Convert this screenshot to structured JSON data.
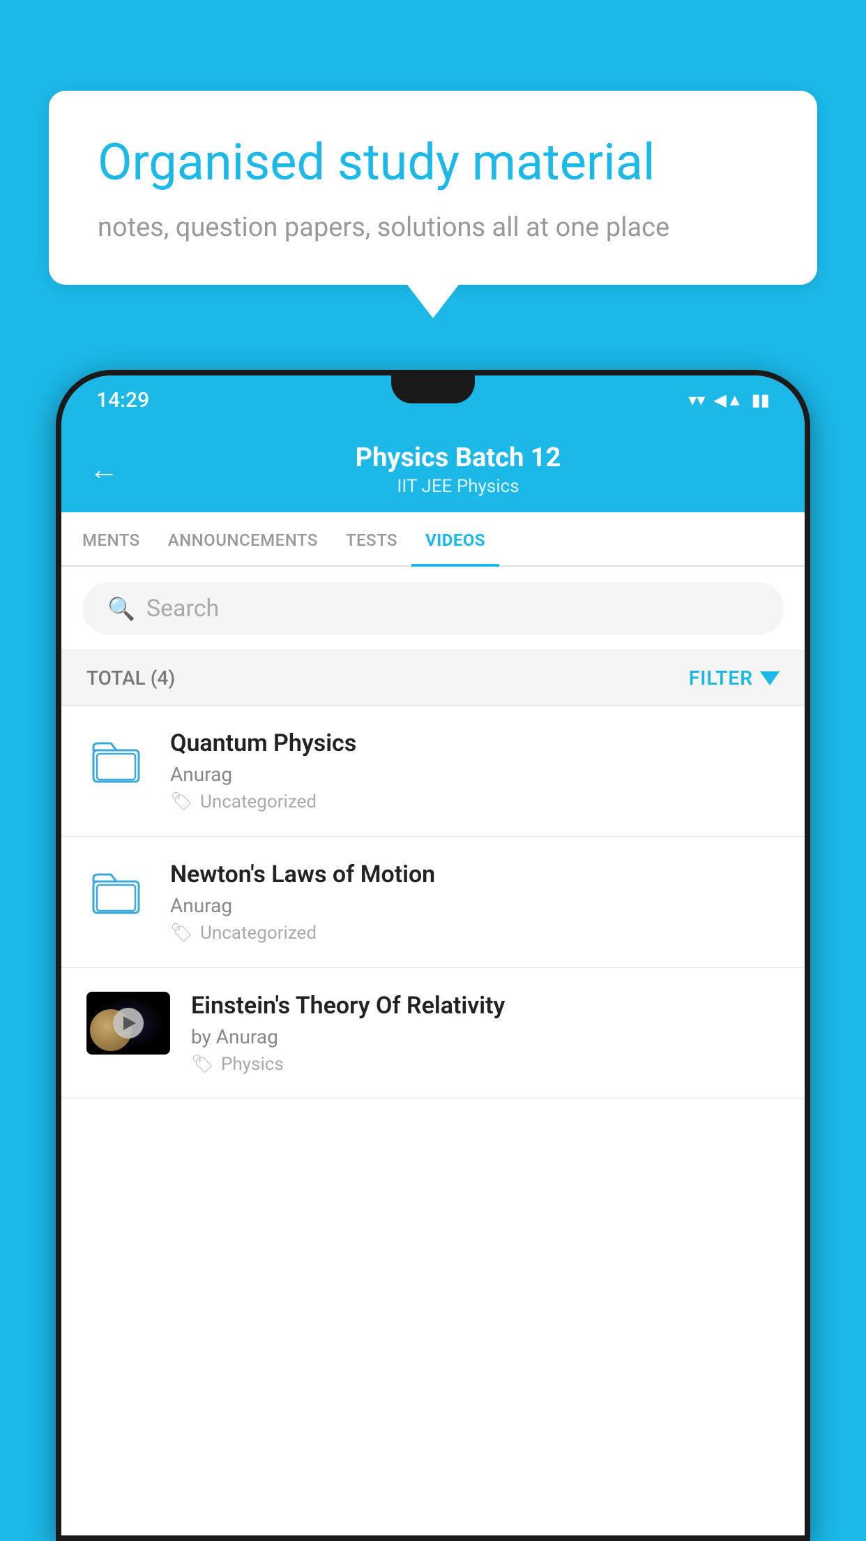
{
  "background_color": "#1bb8e8",
  "speech_bubble": {
    "title": "Organised study material",
    "subtitle": "notes, question papers, solutions all at one place"
  },
  "status_bar": {
    "time": "14:29",
    "wifi": "▾",
    "signal": "▴",
    "battery": "▮"
  },
  "header": {
    "title": "Physics Batch 12",
    "subtitle": "IIT JEE   Physics",
    "back_label": "←"
  },
  "tabs": [
    {
      "id": "ments",
      "label": "MENTS",
      "active": false
    },
    {
      "id": "announcements",
      "label": "ANNOUNCEMENTS",
      "active": false
    },
    {
      "id": "tests",
      "label": "TESTS",
      "active": false
    },
    {
      "id": "videos",
      "label": "VIDEOS",
      "active": true
    }
  ],
  "search": {
    "placeholder": "Search"
  },
  "filter_bar": {
    "total_label": "TOTAL (4)",
    "filter_label": "FILTER"
  },
  "videos": [
    {
      "id": "quantum-physics",
      "title": "Quantum Physics",
      "author": "Anurag",
      "tag": "Uncategorized",
      "type": "folder",
      "has_thumbnail": false
    },
    {
      "id": "newtons-laws",
      "title": "Newton's Laws of Motion",
      "author": "Anurag",
      "tag": "Uncategorized",
      "type": "folder",
      "has_thumbnail": false
    },
    {
      "id": "einstein-relativity",
      "title": "Einstein's Theory Of Relativity",
      "author": "by Anurag",
      "tag": "Physics",
      "type": "video",
      "has_thumbnail": true
    }
  ]
}
